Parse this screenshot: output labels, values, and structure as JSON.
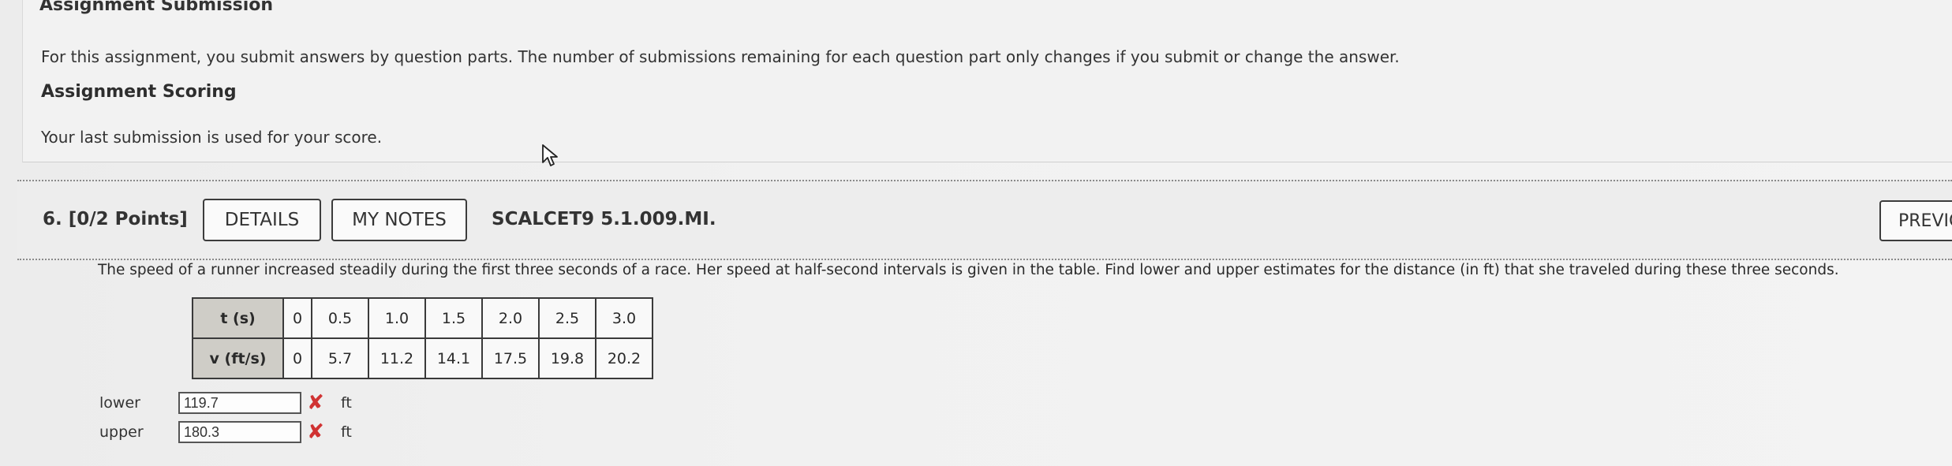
{
  "info": {
    "heading": "Assignment Submission",
    "text": "For this assignment, you submit answers by question parts. The number of submissions remaining for each question part only changes if you submit or change the answer.",
    "scoring_heading": "Assignment Scoring",
    "scoring_text": "Your last submission is used for your score."
  },
  "question": {
    "label": "6.  [0/2 Points]",
    "details_label": "DETAILS",
    "notes_label": "MY NOTES",
    "code": "SCALCET9 5.1.009.MI.",
    "previous_label": "PREVIC",
    "text": "The speed of a runner increased steadily during the first three seconds of a race. Her speed at half-second intervals is given in the table. Find lower and upper estimates for the distance (in ft) that she traveled during these three seconds."
  },
  "table": {
    "row1_header": "t (s)",
    "row1": [
      "0",
      "0.5",
      "1.0",
      "1.5",
      "2.0",
      "2.5",
      "3.0"
    ],
    "row2_header": "v (ft/s)",
    "row2": [
      "0",
      "5.7",
      "11.2",
      "14.1",
      "17.5",
      "19.8",
      "20.2"
    ]
  },
  "answers": {
    "lower_label": "lower",
    "lower_value": "119.7",
    "upper_label": "upper",
    "upper_value": "180.3",
    "unit": "ft",
    "status_icon": "✘"
  },
  "colors": {
    "incorrect": "#d03232",
    "table_header_bg": "#cfcdc7"
  }
}
